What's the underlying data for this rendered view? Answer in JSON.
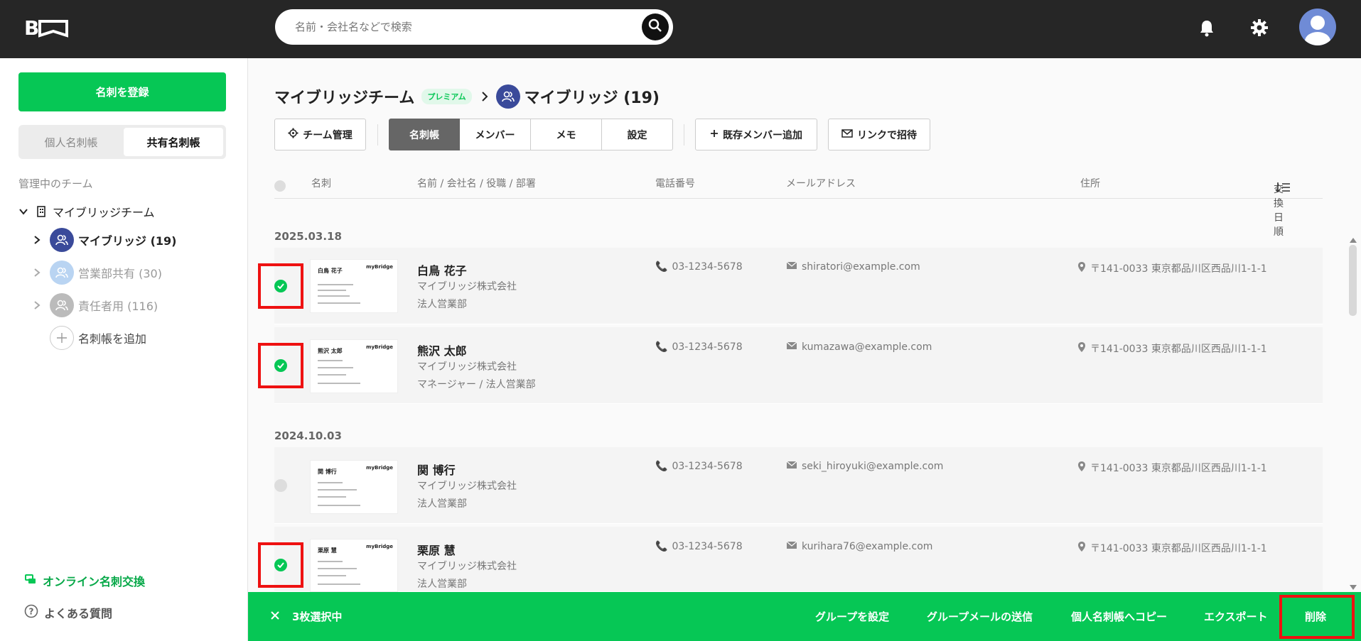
{
  "header": {
    "logo_text": "B",
    "search_placeholder": "名前・会社名などで検索"
  },
  "sidebar": {
    "register_button": "名刺を登録",
    "seg_personal": "個人名刺帳",
    "seg_shared": "共有名刺帳",
    "managed_label": "管理中のチーム",
    "team_name": "マイブリッジチーム",
    "items": [
      {
        "label": "マイブリッジ (19)"
      },
      {
        "label": "営業部共有 (30)"
      },
      {
        "label": "責任者用 (116)"
      }
    ],
    "add_label": "名刺帳を追加",
    "online_exchange": "オンライン名刺交換",
    "faq": "よくある質問"
  },
  "main": {
    "breadcrumb_team": "マイブリッジチーム",
    "premium_badge": "プレミアム",
    "breadcrumb_current": "マイブリッジ (19)",
    "team_manage": "チーム管理",
    "tabs": [
      "名刺帳",
      "メンバー",
      "メモ",
      "設定"
    ],
    "add_member": "既存メンバー追加",
    "invite_link": "リンクで招待",
    "columns": {
      "card": "名刺",
      "name": "名前 / 会社名 / 役職 / 部署",
      "phone": "電話番号",
      "email": "メールアドレス",
      "address": "住所",
      "sort": "交換日順"
    },
    "dates": [
      "2025.03.18",
      "2024.10.03"
    ],
    "contacts": [
      {
        "name": "白鳥 花子",
        "company": "マイブリッジ株式会社",
        "dept": "法人営業部",
        "phone": "03-1234-5678",
        "email": "shiratori@example.com",
        "address": "〒141-0033 東京都品川区西品川1-1-1",
        "checked": true,
        "card_brand": "myBridge"
      },
      {
        "name": "熊沢 太郎",
        "company": "マイブリッジ株式会社",
        "dept": "マネージャー / 法人営業部",
        "phone": "03-1234-5678",
        "email": "kumazawa@example.com",
        "address": "〒141-0033 東京都品川区西品川1-1-1",
        "checked": true,
        "card_brand": "myBridge"
      },
      {
        "name": "関 博行",
        "company": "マイブリッジ株式会社",
        "dept": "法人営業部",
        "phone": "03-1234-5678",
        "email": "seki_hiroyuki@example.com",
        "address": "〒141-0033 東京都品川区西品川1-1-1",
        "checked": false,
        "card_brand": "myBridge"
      },
      {
        "name": "栗原 慧",
        "company": "マイブリッジ株式会社",
        "dept": "法人営業部",
        "phone": "03-1234-5678",
        "email": "kurihara76@example.com",
        "address": "〒141-0033 東京都品川区西品川1-1-1",
        "checked": true,
        "card_brand": "myBridge"
      }
    ]
  },
  "action_bar": {
    "selected": "3枚選択中",
    "set_group": "グループを設定",
    "group_mail": "グループメールの送信",
    "copy_personal": "個人名刺帳へコピー",
    "export": "エクスポート",
    "delete": "削除"
  },
  "colors": {
    "accent": "#06c755",
    "topbar": "#262626",
    "highlight": "#e11111"
  }
}
